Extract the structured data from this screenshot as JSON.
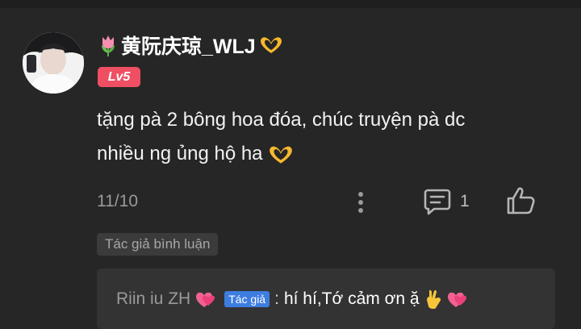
{
  "comment": {
    "user_name": "黄阮庆琼_WLJ",
    "level": "Lv5",
    "text_line1": "tặng pà 2 bông hoa đóa, chúc truyện pà dc",
    "text_line2": "nhiều ng ủng hộ ha",
    "date": "11/10",
    "reply_count": "1"
  },
  "icons": {
    "name_prefix": "tulip-icon",
    "name_suffix": "heart-hands-icon",
    "more": "more-vertical-icon",
    "reply": "comment-icon",
    "like": "thumbs-up-icon"
  },
  "author_tag": "Tác giả bình luận",
  "reply": {
    "author": "Riin iu ZH",
    "badge": "Tác giả",
    "separator": ":",
    "text": "hí hí,Tớ cảm ơn ặ"
  },
  "colors": {
    "background": "#262626",
    "level_badge": "#ef4f63",
    "author_badge": "#3d7de0",
    "reply_box": "#333333"
  }
}
